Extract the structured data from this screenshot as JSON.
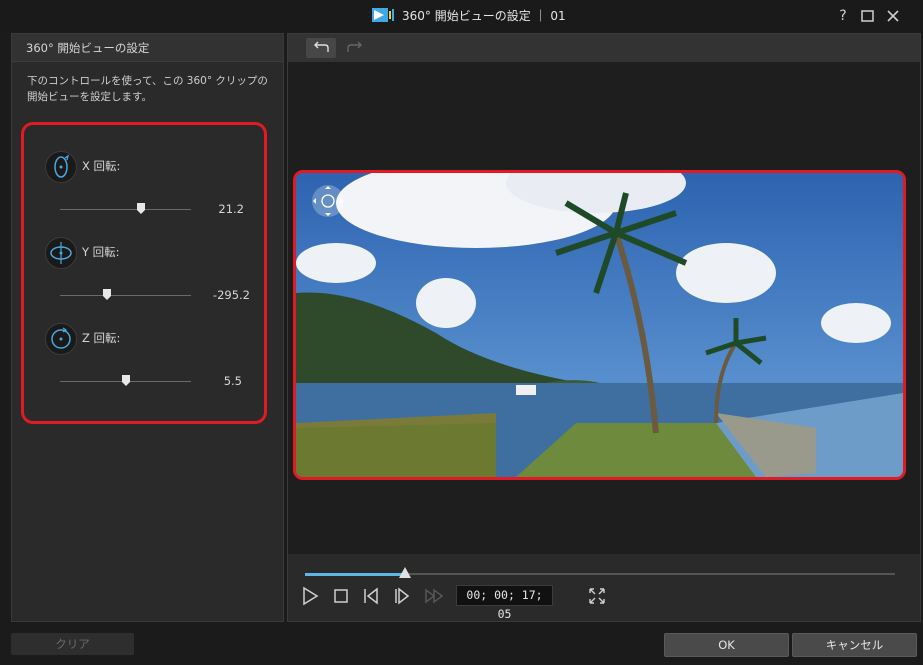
{
  "window": {
    "title": "360° 開始ビューの設定 ｜ 01",
    "help_label": "?",
    "maximize_label": "□",
    "close_label": "✕"
  },
  "left_panel": {
    "header": "360° 開始ビューの設定",
    "description": "下のコントロールを使って、この 360° クリップの開始ビューを設定します。",
    "rotations": [
      {
        "label": "X 回転:",
        "value": "21.2",
        "level": 0.62
      },
      {
        "label": "Y 回転:",
        "value": "-295.2",
        "level": 0.36
      },
      {
        "label": "Z 回転:",
        "value": "5.5",
        "level": 0.5
      }
    ]
  },
  "toolbar": {
    "undo_icon": "undo-arrow-icon",
    "redo_icon": "redo-arrow-icon"
  },
  "player": {
    "timecode": "00; 00; 17; 05",
    "progress": 0.17
  },
  "buttons": {
    "clear": "クリア",
    "ok": "OK",
    "cancel": "キャンセル"
  },
  "colors": {
    "highlight": "#e01b24",
    "seek": "#5db8e8",
    "dialog_bg": "#2a2a2a"
  }
}
